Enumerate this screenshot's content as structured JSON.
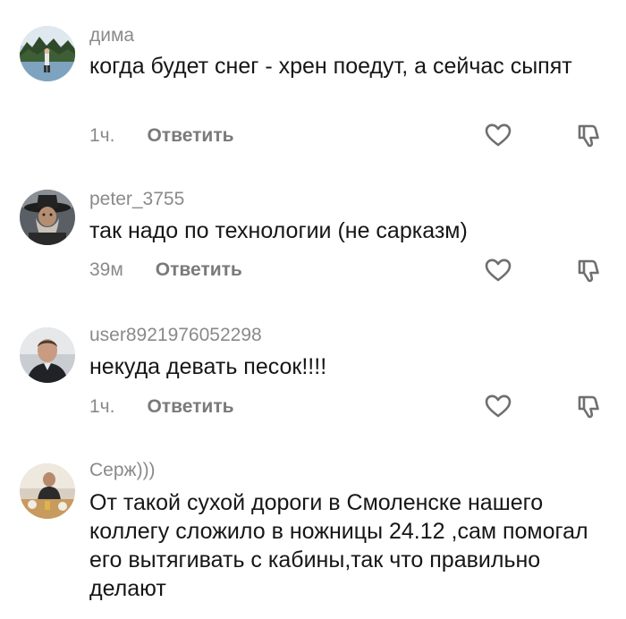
{
  "comments": [
    {
      "username": "дима",
      "text": "когда будет снег - хрен поедут, а сейчас сыпят",
      "time": "1ч.",
      "reply_label": "Ответить",
      "avatar_icon": "landscape-photo-avatar",
      "like_icon": "heart-outline-icon",
      "dislike_icon": "thumbs-down-icon"
    },
    {
      "username": "peter_3755",
      "text": "так надо по технологии (не сарказм)",
      "time": "39м",
      "reply_label": "Ответить",
      "avatar_icon": "bearded-man-hat-avatar",
      "like_icon": "heart-outline-icon",
      "dislike_icon": "thumbs-down-icon"
    },
    {
      "username": "user8921976052298",
      "text": "некуда девать песок!!!!",
      "time": "1ч.",
      "reply_label": "Ответить",
      "avatar_icon": "man-portrait-avatar",
      "like_icon": "heart-outline-icon",
      "dislike_icon": "thumbs-down-icon"
    },
    {
      "username": "Серж)))",
      "text": "От такой сухой дороги в Смоленске нашего коллегу сложило в ножницы 24.12 ,сам помогал его вытягивать с кабины,так что правильно делают",
      "avatar_icon": "man-at-table-avatar"
    }
  ],
  "colors": {
    "text": "#161616",
    "username": "#8a8a8a",
    "reply": "#7a7a7a",
    "icon": "#6f6f6f"
  }
}
